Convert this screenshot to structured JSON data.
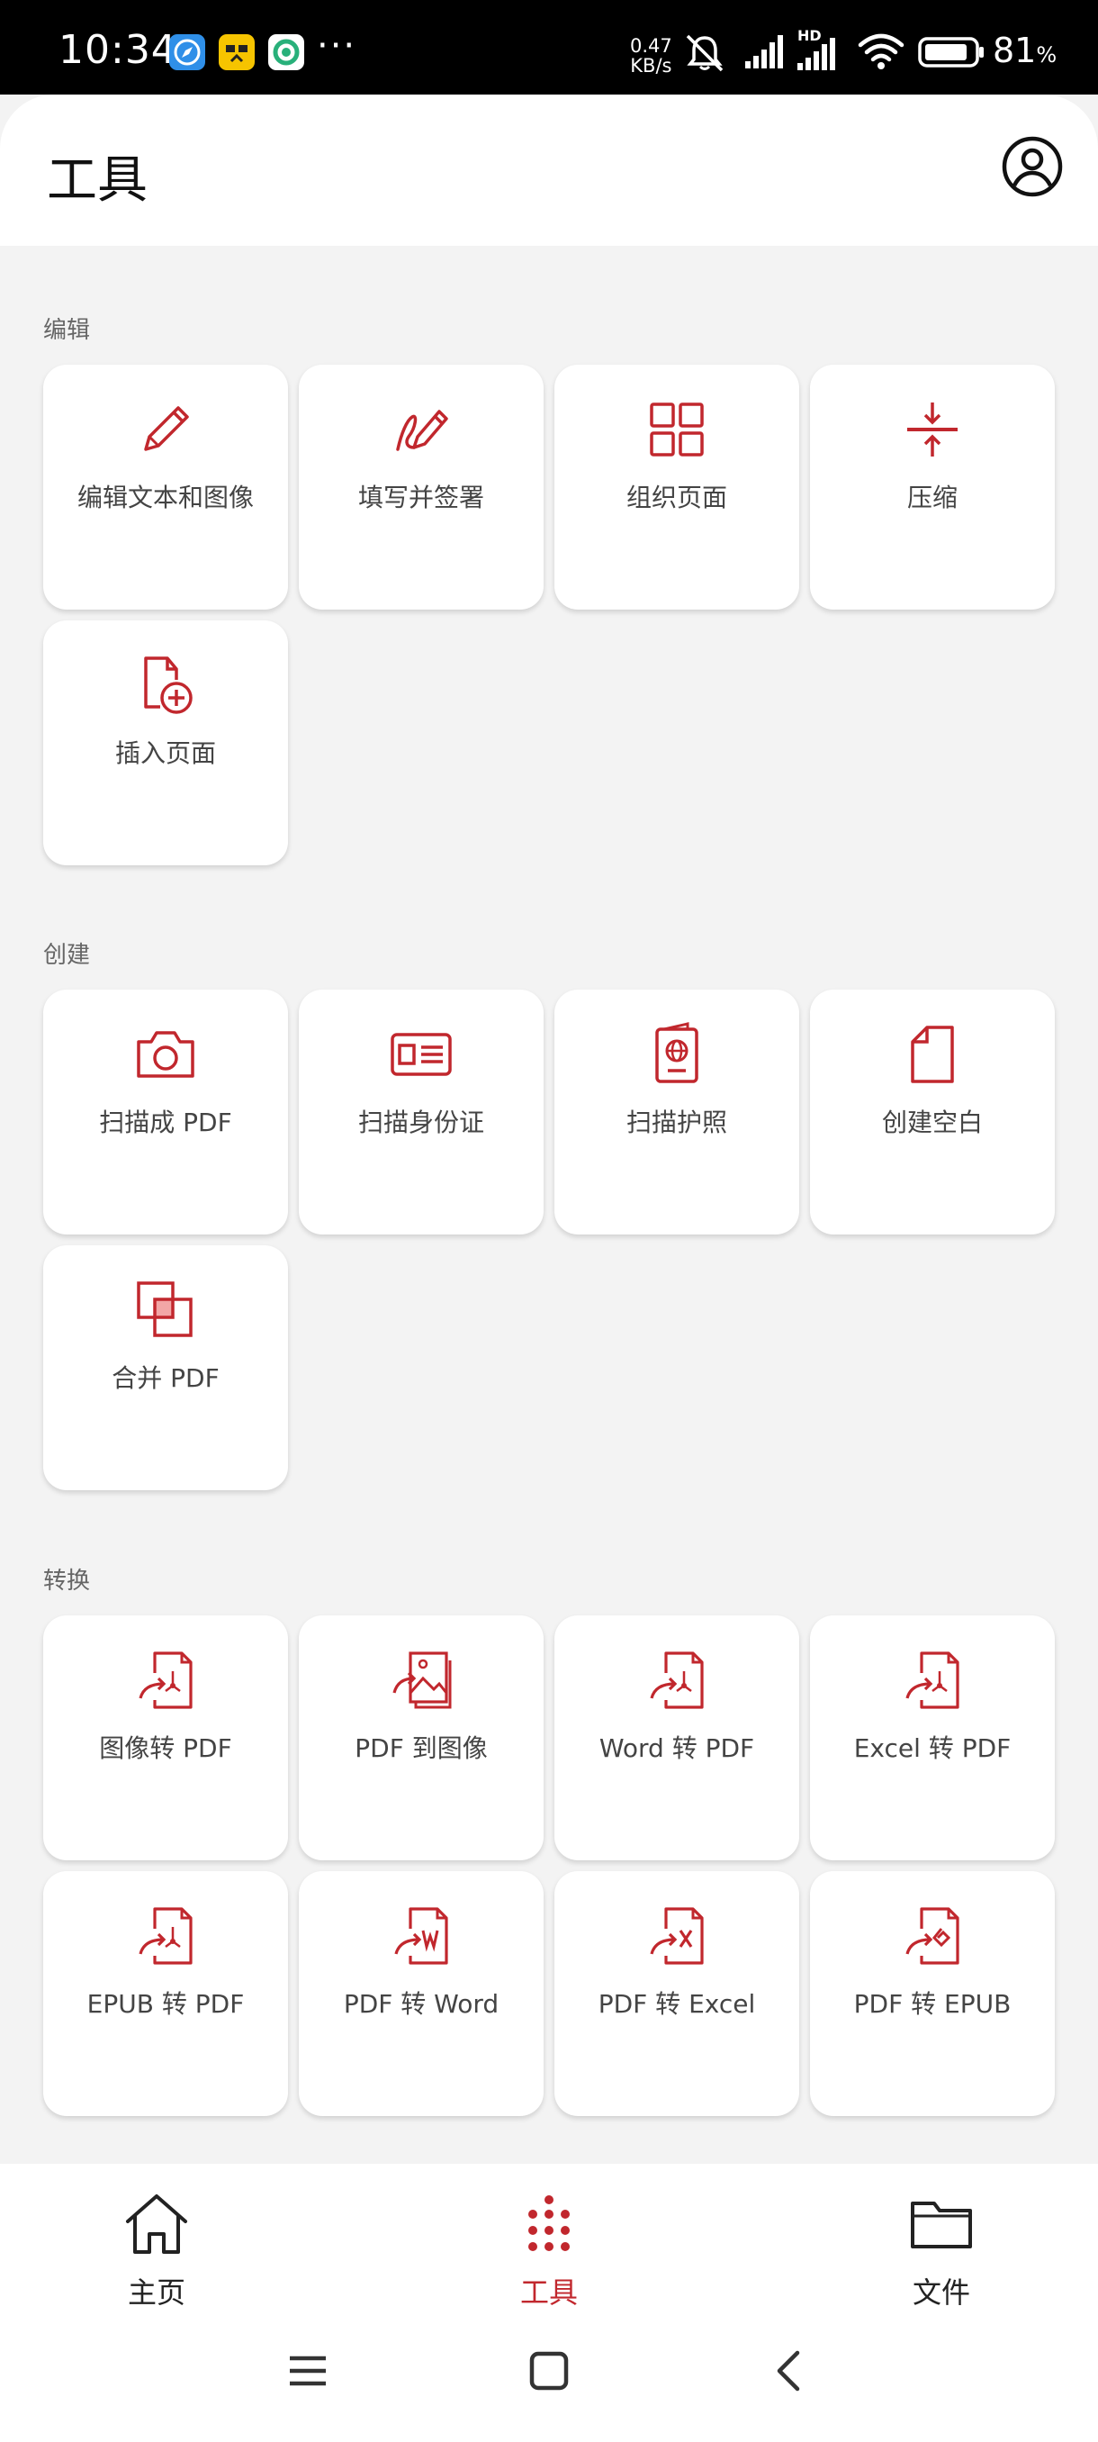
{
  "status_bar": {
    "time": "10:34",
    "more": "···",
    "net_speed_value": "0.47",
    "net_speed_unit": "KB/s",
    "network_type": "HD",
    "battery": "81",
    "battery_unit": "%",
    "app_icons": [
      "compass-app-icon",
      "yellow-app-icon",
      "green-app-icon"
    ],
    "icons": [
      "mute-bell-icon",
      "signal-icon",
      "signal-hd-icon",
      "wifi-icon",
      "battery-icon"
    ]
  },
  "header": {
    "title": "工具",
    "account_icon": "account-circle-icon"
  },
  "colors": {
    "accent": "#c1272d",
    "background": "#f3f3f3",
    "tile": "#ffffff"
  },
  "sections": [
    {
      "label": "编辑",
      "tiles": [
        {
          "label": "编辑文本和图像",
          "icon": "pencil-icon"
        },
        {
          "label": "填写并签署",
          "icon": "sign-pen-icon"
        },
        {
          "label": "组织页面",
          "icon": "grid-icon"
        },
        {
          "label": "压缩",
          "icon": "compress-icon"
        },
        {
          "label": "插入页面",
          "icon": "insert-page-icon"
        }
      ]
    },
    {
      "label": "创建",
      "tiles": [
        {
          "label": "扫描成 PDF",
          "icon": "camera-icon"
        },
        {
          "label": "扫描身份证",
          "icon": "id-card-icon"
        },
        {
          "label": "扫描护照",
          "icon": "passport-icon"
        },
        {
          "label": "创建空白",
          "icon": "blank-page-icon"
        },
        {
          "label": "合并 PDF",
          "icon": "merge-icon"
        }
      ]
    },
    {
      "label": "转换",
      "tiles": [
        {
          "label": "图像转 PDF",
          "icon": "convert-to-pdf-icon"
        },
        {
          "label": "PDF 到图像",
          "icon": "pdf-to-image-icon"
        },
        {
          "label": "Word 转 PDF",
          "icon": "convert-to-pdf-icon"
        },
        {
          "label": "Excel 转 PDF",
          "icon": "convert-to-pdf-icon"
        },
        {
          "label": "EPUB 转 PDF",
          "icon": "convert-to-pdf-icon"
        },
        {
          "label": "PDF 转 Word",
          "icon": "pdf-to-word-icon"
        },
        {
          "label": "PDF 转 Excel",
          "icon": "pdf-to-excel-icon"
        },
        {
          "label": "PDF 转 EPUB",
          "icon": "pdf-to-epub-icon"
        }
      ]
    }
  ],
  "bottom_nav": [
    {
      "label": "主页",
      "icon": "home-icon",
      "active": false
    },
    {
      "label": "工具",
      "icon": "dots-grid-icon",
      "active": true
    },
    {
      "label": "文件",
      "icon": "folder-icon",
      "active": false
    }
  ],
  "system_nav": [
    "menu-icon",
    "home-square-icon",
    "back-icon"
  ]
}
